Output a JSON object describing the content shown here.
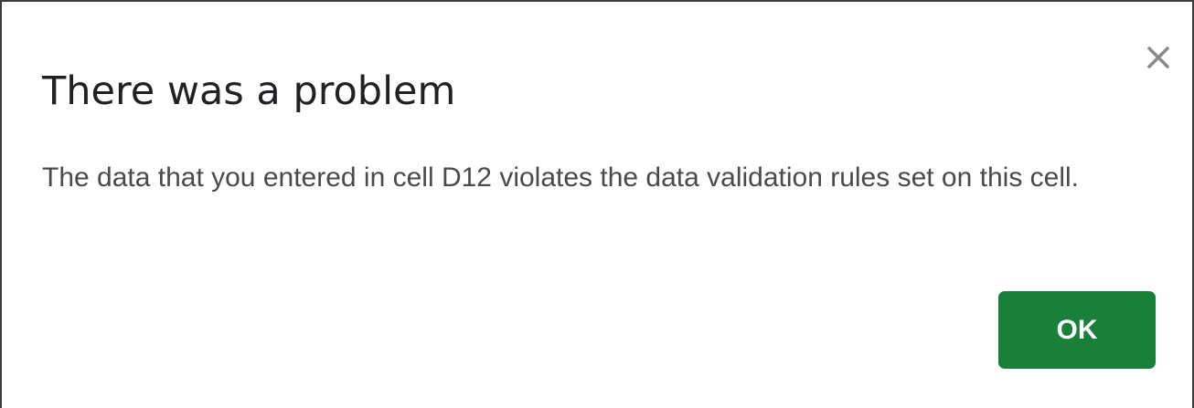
{
  "dialog": {
    "title": "There was a problem",
    "message": "The data that you entered in cell D12 violates the data validation rules set on this cell.",
    "ok_label": "OK",
    "close_icon": "close-icon"
  },
  "colors": {
    "primary_button": "#188038",
    "primary_button_text": "#ffffff",
    "title_text": "#202124",
    "body_text": "#4a4a4a",
    "close_icon": "#8a8a8a"
  }
}
